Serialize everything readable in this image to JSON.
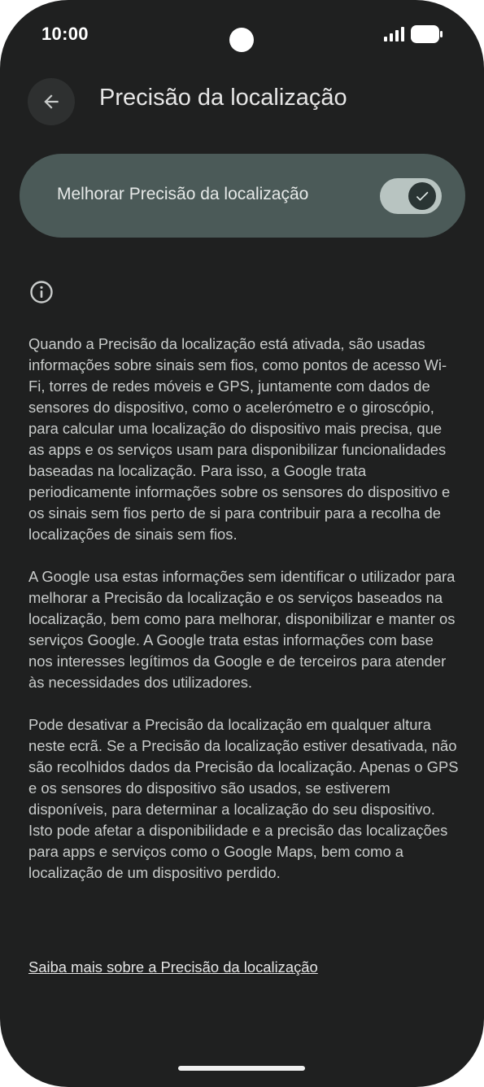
{
  "status_bar": {
    "time": "10:00"
  },
  "header": {
    "title": "Precisão da localização",
    "back_icon": "arrow-back-icon"
  },
  "toggle": {
    "label": "Melhorar Precisão da localização",
    "state": "on",
    "accent_color": "#b8c4c1"
  },
  "info": {
    "icon": "info-icon",
    "paragraphs": [
      "Quando a Precisão da localização está ativada, são usadas informações sobre sinais sem fios, como pontos de acesso Wi-Fi, torres de redes móveis e GPS, juntamente com dados de sensores do dispositivo, como o acelerómetro e o giroscópio, para calcular uma localização do dispositivo mais precisa, que as apps e os serviços usam para disponibilizar funcionalidades baseadas na localização. Para isso, a Google trata periodicamente informações sobre os sensores do dispositivo e os sinais sem fios perto de si para contribuir para a recolha de localizações de sinais sem fios.",
      "A Google usa estas informações sem identificar o utilizador para melhorar a Precisão da localização e os serviços baseados na localização, bem como para melhorar, disponibilizar e manter os serviços Google. A Google trata estas informações com base nos interesses legítimos da Google e de terceiros para atender às necessidades dos utilizadores.",
      "Pode desativar a Precisão da localização em qualquer altura neste ecrã. Se a Precisão da localização estiver desativada, não são recolhidos dados da Precisão da localização. Apenas o GPS e os sensores do dispositivo são usados, se estiverem disponíveis, para determinar a localização do seu dispositivo. Isto pode afetar a disponibilidade e a precisão das localizações para apps e serviços como o Google Maps, bem como a localização de um dispositivo perdido."
    ],
    "learn_more_link": "Saiba mais sobre a Precisão da localização"
  }
}
